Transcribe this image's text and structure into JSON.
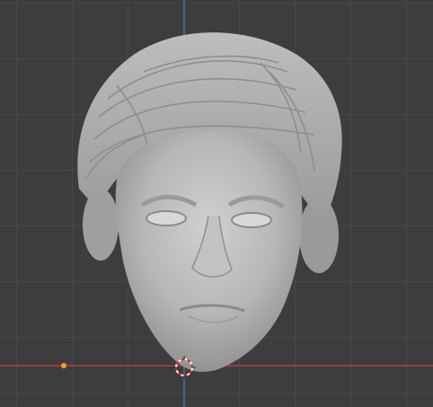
{
  "viewport": {
    "background": "#3d3d3d",
    "grid_color": "#474747",
    "x_axis_color": "#9b3a46",
    "y_axis_color": "#3f6a9e",
    "origin_color": "#f0a030"
  },
  "model": {
    "icon": "head-sculpt-icon",
    "material_color": "#b3b3b3"
  },
  "cursor": {
    "icon": "3d-cursor-icon"
  }
}
